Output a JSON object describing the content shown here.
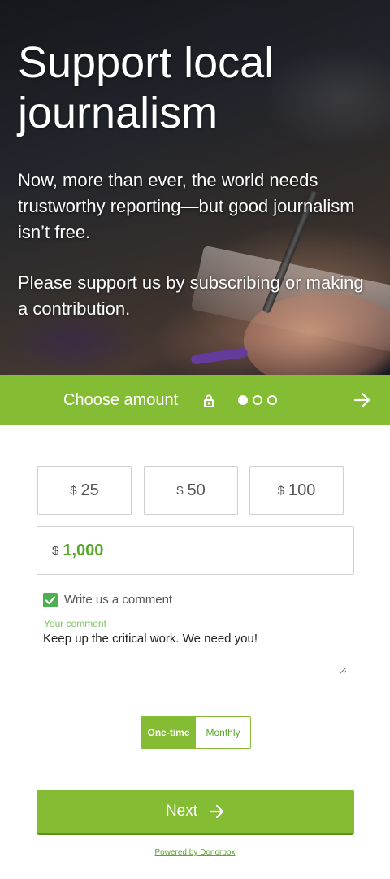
{
  "hero": {
    "title": "Support local journalism",
    "paragraph1": "Now, more than ever, the world needs trustworthy reporting—but good journalism isn’t free.",
    "paragraph2": "Please support us by subscribing or making a contribution."
  },
  "step": {
    "title": "Choose amount",
    "icons": [
      "lock-icon",
      "arrow-right-icon"
    ],
    "total_steps": 3,
    "current_step": 1
  },
  "amounts": {
    "currency": "$",
    "options": [
      "25",
      "50",
      "100"
    ],
    "custom_value": "1,000"
  },
  "comment": {
    "checkbox_label": "Write us a comment",
    "checked": true,
    "field_label": "Your comment",
    "value": "Keep up the critical work. We need you!"
  },
  "frequency": {
    "one_time": "One-time",
    "monthly": "Monthly",
    "selected": "One-time"
  },
  "next_button": {
    "label": "Next"
  },
  "footer": {
    "powered_by": "Powered by Donorbox"
  },
  "colors": {
    "accent": "#84bc33",
    "accent_text": "#5aa52b",
    "check": "#4caf50"
  }
}
